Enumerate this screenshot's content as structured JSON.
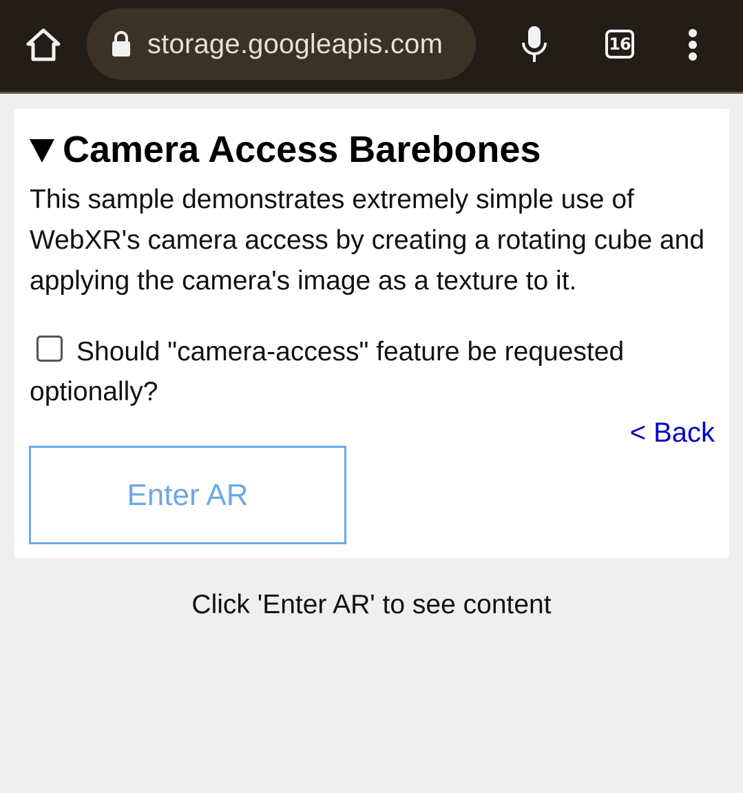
{
  "browser": {
    "url": "storage.googleapis.com",
    "tab_count": "16",
    "icons": {
      "home": "home-icon",
      "lock": "lock-icon",
      "mic": "microphone-icon",
      "tabs": "tab-switcher-icon",
      "menu": "more-vert-icon"
    },
    "colors": {
      "toolbar": "#231d17",
      "omnibox": "#3c3125"
    }
  },
  "page": {
    "title": "Camera Access Barebones",
    "description": "This sample demonstrates extremely simple use of WebXR's camera access by creating a rotating cube and applying the camera's image as a texture to it.",
    "option_label": "Should \"camera-access\" feature be requested optionally?",
    "option_checked": false,
    "back_link": "< Back",
    "enter_ar_button": "Enter AR",
    "hint": "Click 'Enter AR' to see content",
    "colors": {
      "link": "#0000cc",
      "button_accent": "#6aa8ec",
      "background": "#efefef"
    }
  }
}
